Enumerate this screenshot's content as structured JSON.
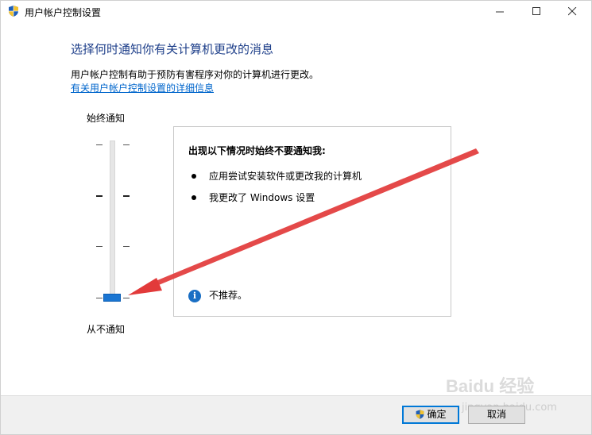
{
  "window": {
    "title": "用户帐户控制设置"
  },
  "content": {
    "heading": "选择何时通知你有关计算机更改的消息",
    "description": "用户帐户控制有助于预防有害程序对你的计算机进行更改。",
    "more_link": "有关用户帐户控制设置的详细信息"
  },
  "slider": {
    "top_label": "始终通知",
    "bottom_label": "从不通知",
    "levels": 4,
    "selected_level": 1,
    "accent": "#1a75d2"
  },
  "panel": {
    "title": "出现以下情况时始终不要通知我:",
    "bullets": [
      "应用尝试安装软件或更改我的计算机",
      "我更改了 Windows 设置"
    ],
    "info_icon": "info-icon",
    "info_text": "不推荐。"
  },
  "annotation": {
    "arrow_color": "#e23a3a"
  },
  "buttons": {
    "ok_label": "确定",
    "cancel_label": "取消"
  },
  "watermark": {
    "text": "Baidu 经验",
    "sub": "jingyan.baidu.com"
  }
}
